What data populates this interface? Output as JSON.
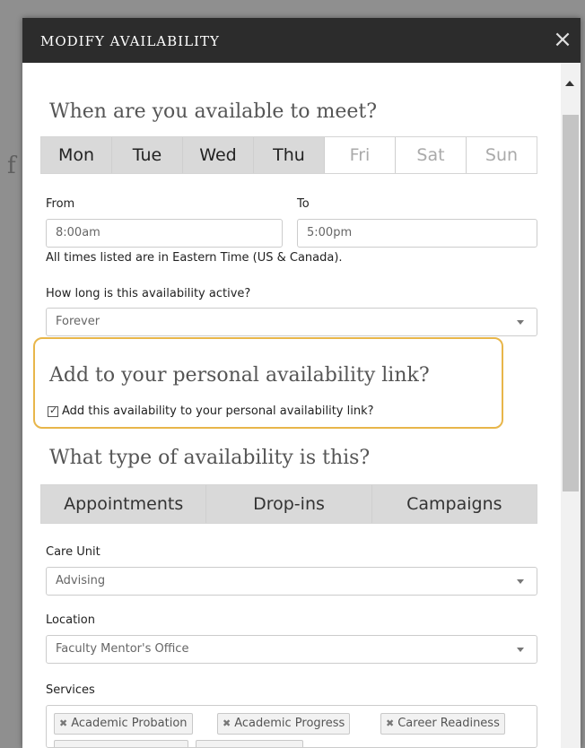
{
  "modal": {
    "title": "MODIFY AVAILABILITY",
    "close_label": "×"
  },
  "days_section": {
    "heading": "When are you available to meet?",
    "days": [
      {
        "label": "Mon",
        "selected": true
      },
      {
        "label": "Tue",
        "selected": true
      },
      {
        "label": "Wed",
        "selected": true
      },
      {
        "label": "Thu",
        "selected": true
      },
      {
        "label": "Fri",
        "selected": false
      },
      {
        "label": "Sat",
        "selected": false
      },
      {
        "label": "Sun",
        "selected": false
      }
    ]
  },
  "time": {
    "from_label": "From",
    "from_value": "8:00am",
    "to_label": "To",
    "to_value": "5:00pm",
    "timezone_note": "All times listed are in Eastern Time (US & Canada)."
  },
  "duration": {
    "label": "How long is this availability active?",
    "value": "Forever"
  },
  "personal_link": {
    "heading": "Add to your personal availability link?",
    "checkbox_label": "Add this availability to your personal availability link?",
    "checked": true
  },
  "type_section": {
    "heading": "What type of availability is this?",
    "types": [
      "Appointments",
      "Drop-ins",
      "Campaigns"
    ]
  },
  "care_unit": {
    "label": "Care Unit",
    "value": "Advising"
  },
  "location": {
    "label": "Location",
    "value": "Faculty Mentor's Office"
  },
  "services": {
    "label": "Services",
    "tags": [
      "Academic Probation",
      "Academic Progress",
      "Career Readiness"
    ]
  },
  "colors": {
    "header_bg": "#2c2c2c",
    "selected_day_bg": "#d9d9d9",
    "highlight_border": "#e8b64a"
  },
  "icons": {
    "close": "close-icon",
    "dropdown": "chevron-down-icon",
    "tag_remove": "remove-x-icon",
    "checkbox": "checkbox-checked-icon"
  }
}
